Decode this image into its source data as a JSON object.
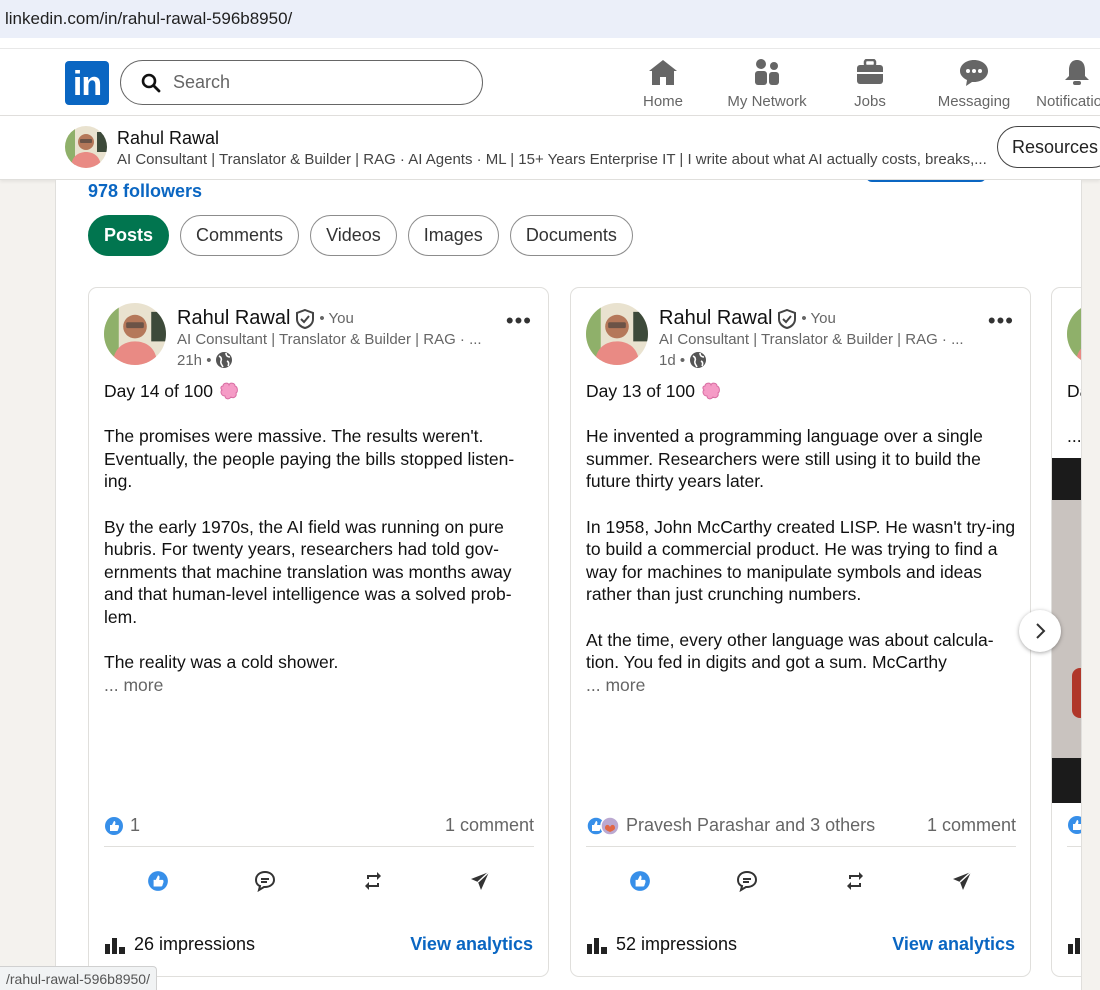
{
  "browser": {
    "url": "linkedin.com/in/rahul-rawal-596b8950/",
    "status_url": "/rahul-rawal-596b8950/"
  },
  "nav": {
    "search_placeholder": "Search",
    "items": [
      {
        "label": "Home",
        "icon": "home-icon"
      },
      {
        "label": "My Network",
        "icon": "network-icon"
      },
      {
        "label": "Jobs",
        "icon": "briefcase-icon"
      },
      {
        "label": "Messaging",
        "icon": "messaging-icon"
      },
      {
        "label": "Notifications",
        "icon": "bell-icon"
      }
    ],
    "logo_text": "in"
  },
  "profile_bar": {
    "name": "Rahul Rawal",
    "headline": "AI Consultant | Translator & Builder | RAG · AI Agents · ML | 15+ Years Enterprise IT | I write about what AI actually costs, breaks,...",
    "resources_label": "Resources"
  },
  "activity": {
    "followers": "978 followers",
    "filters": [
      {
        "label": "Posts",
        "active": true
      },
      {
        "label": "Comments",
        "active": false
      },
      {
        "label": "Videos",
        "active": false
      },
      {
        "label": "Images",
        "active": false
      },
      {
        "label": "Documents",
        "active": false
      }
    ]
  },
  "posts": [
    {
      "author": "Rahul Rawal",
      "you": "• You",
      "subline": "AI Consultant | Translator & Builder | RAG · ...",
      "time": "21h •",
      "day": "Day 14 of 100",
      "paragraphs": [
        "The promises were massive. The results weren't. Eventually, the people paying the bills stopped listen-ing.",
        "By the early 1970s, the AI field was running on pure hubris. For twenty years, researchers had told gov-ernments that machine translation was months away and that human-level intelligence was a solved prob-lem.",
        "The reality was a cold shower."
      ],
      "more": "... more",
      "reactions": "1",
      "comments": "1 comment",
      "impressions": "26 impressions",
      "analytics": "View analytics"
    },
    {
      "author": "Rahul Rawal",
      "you": "• You",
      "subline": "AI Consultant | Translator & Builder | RAG · ...",
      "time": "1d •",
      "day": "Day 13 of 100",
      "paragraphs": [
        "He invented a programming language over a single summer. Researchers were still using it to build the future thirty years later.",
        "In 1958, John McCarthy created LISP. He wasn't try-ing to build a commercial product. He was trying to find a way for machines to manipulate symbols and ideas rather than just crunching numbers.",
        "At the time, every other language was about calcula-tion. You fed in digits and got a sum. McCarthy"
      ],
      "more": "... more",
      "reactions": "Pravesh Parashar and 3 others",
      "comments": "1 comment",
      "impressions": "52 impressions",
      "analytics": "View analytics"
    }
  ],
  "partial_post": {
    "day_prefix": "Da",
    "ellipsis": "..."
  },
  "colors": {
    "brand": "#0a66c2",
    "active_chip": "#01754f"
  }
}
